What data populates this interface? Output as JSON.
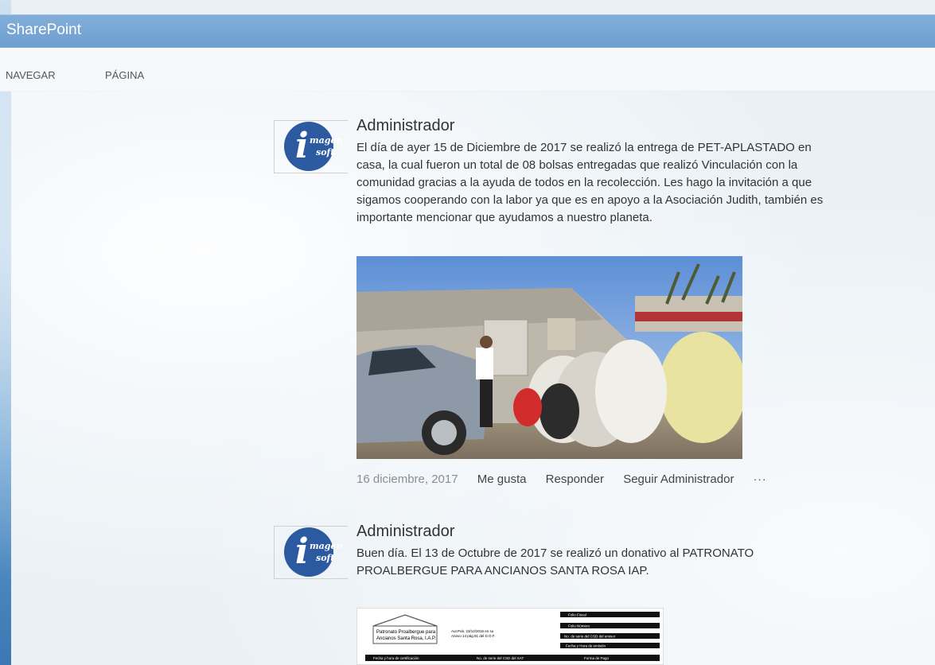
{
  "app": {
    "title": "SharePoint"
  },
  "ribbon": {
    "tabs": [
      "NAVEGAR",
      "PÁGINA"
    ]
  },
  "posts": [
    {
      "author": "Administrador",
      "text_lines": [
        "El día de ayer 15 de Diciembre de 2017 se realizó la entrega de PET-APLASTADO en",
        "casa, la cual fueron un total de 08 bolsas entregadas que realizó Vinculación con la",
        "comunidad gracias a la ayuda de todos en la recolección. Les hago la invitación a que",
        "sigamos cooperando con la labor ya que es en apoyo a la Asociación Judith, también es",
        "importante mencionar que ayudamos a nuestro planeta."
      ],
      "date": "16 diciembre, 2017",
      "actions": {
        "like": "Me gusta",
        "reply": "Responder",
        "follow": "Seguir Administrador",
        "more": "···"
      }
    },
    {
      "author": "Administrador",
      "text_lines": [
        "Buen día. El 13 de Octubre de 2017 se realizó un donativo al PATRONATO",
        "PROALBERGUE PARA ANCIANOS SANTA ROSA IAP."
      ]
    }
  ],
  "avatar": {
    "brand_top": "magen",
    "brand_bottom": "soft",
    "letter": "i"
  },
  "document_preview": {
    "org_line1": "Patronato Proalbergue para",
    "org_line2": "Ancianos Santa Rosa, I.A.P.",
    "auth_line1": "Aut.Pub. 23/12/2016 en su",
    "auth_line2": "Anexo 14 pág.91 del D.O.F.",
    "rows": [
      "Folio Fiscal",
      "Folio Número",
      "No. de serie del CSD del emisor",
      "Fecha y Hora de emisión"
    ],
    "table_headers": [
      "Fecha y hora de certificación",
      "No. de serie del CSD del SAT",
      "Forma de Pago"
    ]
  },
  "colors": {
    "suitebar": "#6d9fd1",
    "avatar": "#2c5aa0",
    "link": "#444444"
  }
}
